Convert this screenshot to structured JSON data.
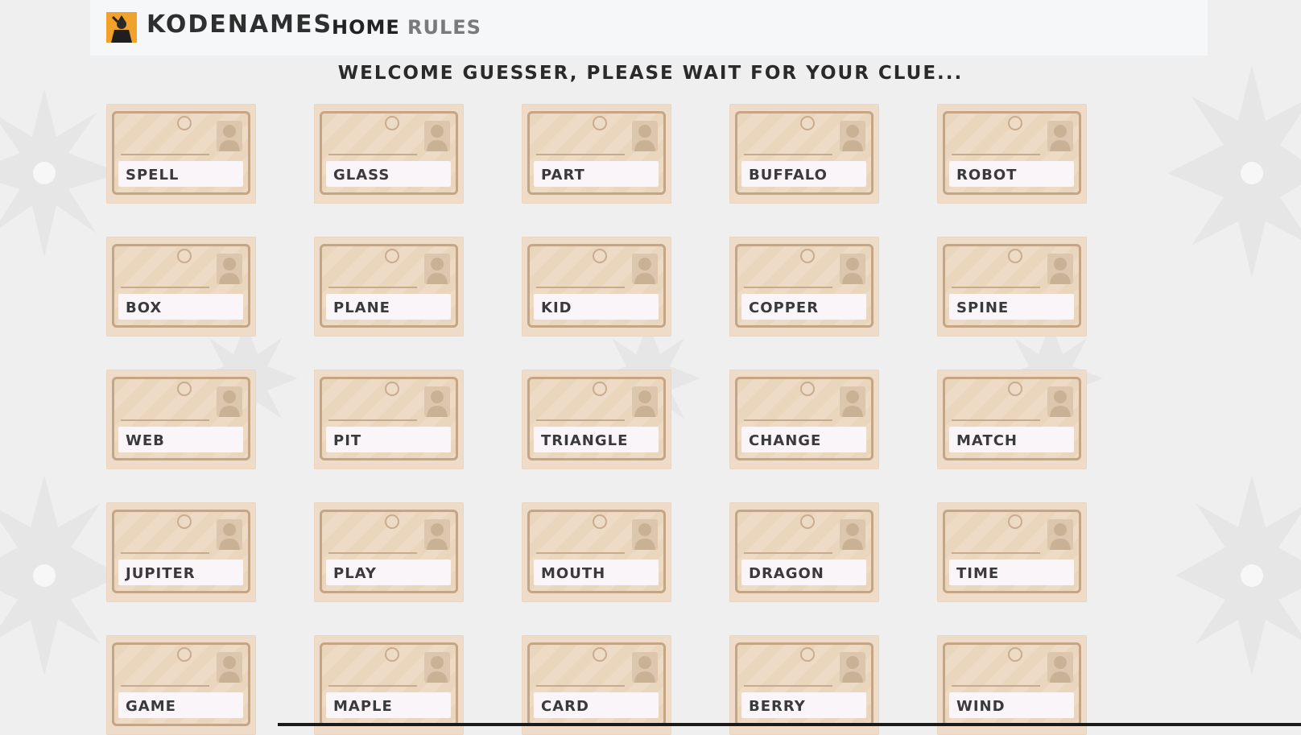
{
  "nav": {
    "brand": "KODENAMES",
    "home_label": "HOME",
    "rules_label": "RULES",
    "logo_icon": "spy-icon"
  },
  "status_message": "WELCOME GUESSER, PLEASE WAIT FOR YOUR CLUE...",
  "colors": {
    "card_bg": "#efdcc8",
    "card_border": "#c4a585",
    "logo_bg": "#f2a22a",
    "text_dark": "#2a2a2a",
    "nav_inactive": "#7a7a7a"
  },
  "board": {
    "rows": [
      [
        "SPELL",
        "GLASS",
        "PART",
        "BUFFALO",
        "ROBOT"
      ],
      [
        "BOX",
        "PLANE",
        "KID",
        "COPPER",
        "SPINE"
      ],
      [
        "WEB",
        "PIT",
        "TRIANGLE",
        "CHANGE",
        "MATCH"
      ],
      [
        "JUPITER",
        "PLAY",
        "MOUTH",
        "DRAGON",
        "TIME"
      ],
      [
        "GAME",
        "MAPLE",
        "CARD",
        "BERRY",
        "WIND"
      ]
    ]
  }
}
